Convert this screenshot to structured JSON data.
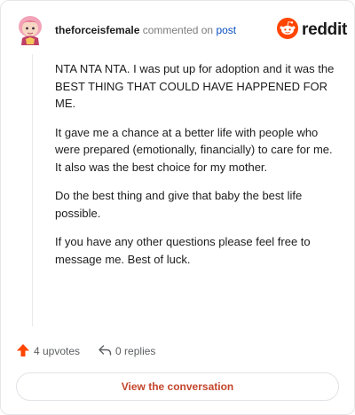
{
  "comment": {
    "username": "theforceisfemale",
    "verb": "commented on",
    "post_link": "post",
    "paragraphs": [
      "NTA NTA NTA. I was put up for adoption and it was the BEST THING THAT COULD HAVE HAPPENED FOR ME.",
      "It gave me a chance at a better life with people who were prepared (emotionally, financially) to care for me. It also was the best choice for my mother.",
      "Do the best thing and give that baby the best life possible.",
      "If you have any other questions please feel free to message me. Best of luck."
    ]
  },
  "brand": {
    "name": "reddit",
    "color": "#ff4500"
  },
  "stats": {
    "upvotes": "4 upvotes",
    "replies": "0 replies",
    "upvote_color": "#ff4500"
  },
  "cta": {
    "label": "View the conversation",
    "color": "#c4462d"
  },
  "icons": [
    "user-avatar",
    "reddit-logo-icon",
    "upvote-arrow-icon",
    "reply-arrow-icon"
  ]
}
